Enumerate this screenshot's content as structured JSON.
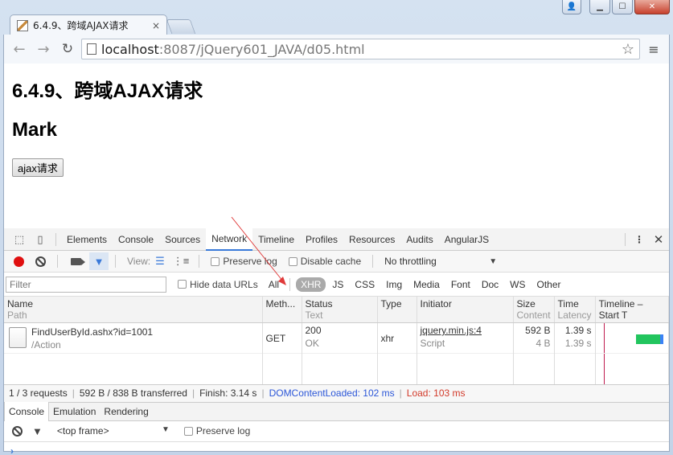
{
  "browser": {
    "tab_title": "6.4.9、跨域AJAX请求",
    "tab_close": "×",
    "url_host": "localhost",
    "url_rest": ":8087/jQuery601_JAVA/d05.html"
  },
  "window_controls": {
    "user_glyph": "👤",
    "minimize": "▁",
    "maximize": "☐",
    "close": "✕"
  },
  "icons": {
    "back": "←",
    "forward": "→",
    "reload": "↻",
    "star": "☆",
    "menu": "≡",
    "inspect": "⬚",
    "device": "▯",
    "filter": "▼",
    "view_list": "☰",
    "view_waterfall": "⋮≡",
    "more": "⋮",
    "close": "✕",
    "dropdown": "▼",
    "prompt": "›"
  },
  "page": {
    "heading1": "6.4.9、跨域AJAX请求",
    "heading2": "Mark",
    "button_label": "ajax请求"
  },
  "devtools": {
    "tabs": [
      "Elements",
      "Console",
      "Sources",
      "Network",
      "Timeline",
      "Profiles",
      "Resources",
      "Audits",
      "AngularJS"
    ],
    "active_tab": "Network",
    "toolbar": {
      "view_label": "View:",
      "preserve_log": "Preserve log",
      "disable_cache": "Disable cache",
      "throttling": "No throttling"
    },
    "filter": {
      "placeholder": "Filter",
      "hide_data_urls": "Hide data URLs",
      "types": [
        "All",
        "XHR",
        "JS",
        "CSS",
        "Img",
        "Media",
        "Font",
        "Doc",
        "WS",
        "Other"
      ],
      "active_type": "XHR"
    },
    "columns": {
      "name": "Name",
      "name_sub": "Path",
      "method": "Meth...",
      "status": "Status",
      "status_sub": "Text",
      "type": "Type",
      "initiator": "Initiator",
      "size": "Size",
      "size_sub": "Content",
      "time": "Time",
      "time_sub": "Latency",
      "timeline": "Timeline – Start T"
    },
    "request": {
      "name": "FindUserById.ashx?id=1001",
      "path": "/Action",
      "method": "GET",
      "status": "200",
      "status_text": "OK",
      "type": "xhr",
      "initiator": "jquery.min.js:4",
      "initiator_type": "Script",
      "size": "592 B",
      "content": "4 B",
      "time": "1.39 s",
      "latency": "1.39 s"
    },
    "status_bar": {
      "requests": "1 / 3 requests",
      "transferred": "592 B / 838 B transferred",
      "finish": "Finish: 3.14 s",
      "dcl": "DOMContentLoaded: 102 ms",
      "load": "Load: 103 ms"
    },
    "drawer_tabs": [
      "Console",
      "Emulation",
      "Rendering"
    ],
    "console": {
      "frame": "<top frame>",
      "preserve_log": "Preserve log"
    }
  },
  "colors": {
    "accent": "#3879d9",
    "record": "#e01010",
    "annotation_arrow": "#e03a3a",
    "dcl": "#2c57d8",
    "load": "#d23a2a",
    "timeline_bar": "#22c55e"
  }
}
